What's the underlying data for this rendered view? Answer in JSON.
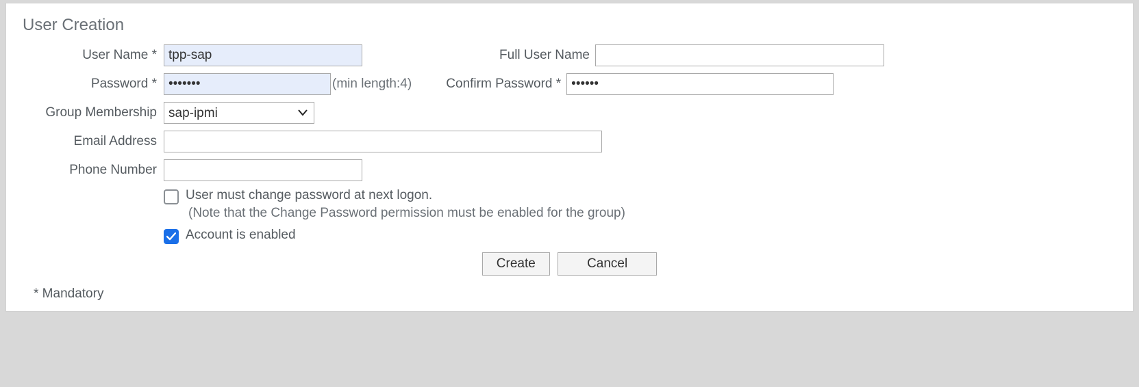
{
  "section_title": "User Creation",
  "labels": {
    "user_name": "User Name *",
    "full_user_name": "Full User Name",
    "password": "Password *",
    "confirm_password": "Confirm Password *",
    "group_membership": "Group Membership",
    "email_address": "Email Address",
    "phone_number": "Phone Number"
  },
  "values": {
    "user_name": "tpp-sap",
    "full_user_name": "",
    "password": "•••••••",
    "confirm_password": "••••••",
    "group_membership": "sap-ipmi",
    "email_address": "",
    "phone_number": ""
  },
  "hints": {
    "password_min": "(min length:4)"
  },
  "checkboxes": {
    "must_change_label": "User must change password at next logon.",
    "must_change_note": "(Note that the Change Password permission must be enabled for the group)",
    "account_enabled_label": "Account is enabled"
  },
  "buttons": {
    "create": "Create",
    "cancel": "Cancel"
  },
  "footer": {
    "mandatory": "* Mandatory"
  }
}
